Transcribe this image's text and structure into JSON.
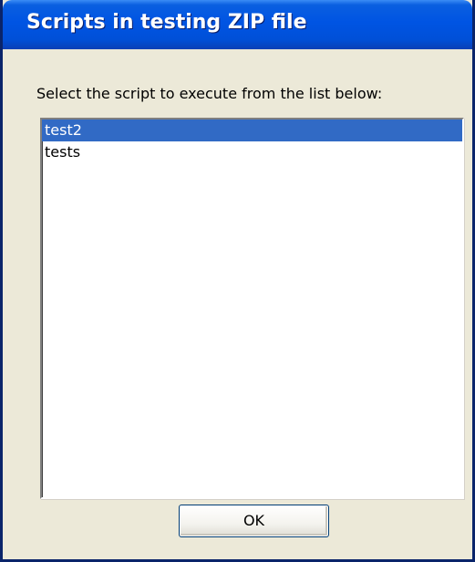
{
  "window": {
    "title": "Scripts in testing ZIP file"
  },
  "dialog": {
    "instruction": "Select the script to execute from the list below:",
    "scripts": [
      {
        "label": "test2",
        "selected": true
      },
      {
        "label": "tests",
        "selected": false
      }
    ],
    "ok_label": "OK"
  },
  "colors": {
    "titlebar": "#0054e3",
    "selection": "#316ac5",
    "dialog_background": "#ece9d8"
  }
}
